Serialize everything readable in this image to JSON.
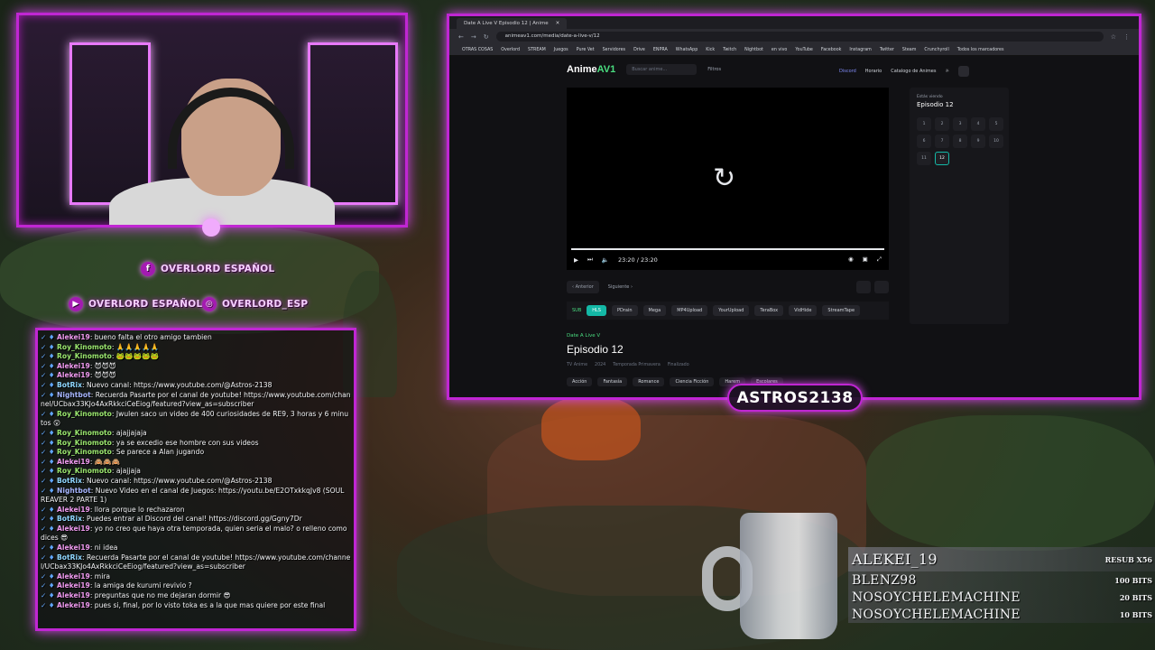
{
  "overlay": {
    "social_facebook": "OVERLORD ESPAÑOL",
    "social_youtube": "OVERLORD ESPAÑOL",
    "social_instagram": "OVERLORD_ESP",
    "streamer_name": "ASTROS2138"
  },
  "chat": [
    {
      "user": "Alekei19",
      "cls": "u-alekei",
      "msg": "bueno falta el otro amigo tambien"
    },
    {
      "user": "Roy_Kinomoto",
      "cls": "u-roy",
      "msg": "🙏🙏🙏🙏🙏"
    },
    {
      "user": "Roy_Kinomoto",
      "cls": "u-roy",
      "msg": "🐸🐸🐸🐸🐸"
    },
    {
      "user": "Alekei19",
      "cls": "u-alekei",
      "msg": "😈😈😈"
    },
    {
      "user": "Alekei19",
      "cls": "u-alekei",
      "msg": "😈😈😈"
    },
    {
      "user": "BotRix",
      "cls": "u-botrix",
      "msg": "Nuevo canal: https://www.youtube.com/@Astros-2138"
    },
    {
      "user": "Nightbot",
      "cls": "u-nightbot",
      "msg": "Recuerda Pasarte por el canal de youtube! https://www.youtube.com/channel/UCbax33KJo4AxRkkciCeEiog/featured?view_as=subscriber"
    },
    {
      "user": "Roy_Kinomoto",
      "cls": "u-roy",
      "msg": "Jwulen saco un video de 400 curiosidades de RE9, 3 horas y 6 minutos 😮"
    },
    {
      "user": "Roy_Kinomoto",
      "cls": "u-roy",
      "msg": "ajajjajaja"
    },
    {
      "user": "Roy_Kinomoto",
      "cls": "u-roy",
      "msg": "ya se excedio ese hombre con sus videos"
    },
    {
      "user": "Roy_Kinomoto",
      "cls": "u-roy",
      "msg": "Se parece a Alan jugando"
    },
    {
      "user": "Alekei19",
      "cls": "u-alekei",
      "msg": "🙈🙈🙈"
    },
    {
      "user": "Roy_Kinomoto",
      "cls": "u-roy",
      "msg": "ajajjaja"
    },
    {
      "user": "BotRix",
      "cls": "u-botrix",
      "msg": "Nuevo canal: https://www.youtube.com/@Astros-2138"
    },
    {
      "user": "Nightbot",
      "cls": "u-nightbot",
      "msg": "Nuevo Video en el canal de Juegos: https://youtu.be/E2OTxkkqJv8 (SOUL REAVER 2 PARTE 1)"
    },
    {
      "user": "Alekei19",
      "cls": "u-alekei",
      "msg": "llora porque lo rechazaron"
    },
    {
      "user": "BotRix",
      "cls": "u-botrix",
      "msg": "Puedes entrar al Discord del canal! https://discord.gg/Ggny7Dr"
    },
    {
      "user": "Alekei19",
      "cls": "u-alekei",
      "msg": "yo no creo que haya otra temporada, quien seria el malo? o relleno como dices 😎"
    },
    {
      "user": "Alekei19",
      "cls": "u-alekei",
      "msg": "ni idea"
    },
    {
      "user": "BotRix",
      "cls": "u-botrix",
      "msg": "Recuerda Pasarte por el canal de youtube! https://www.youtube.com/channel/UCbax33KJo4AxRkkciCeEiog/featured?view_as=subscriber"
    },
    {
      "user": "Alekei19",
      "cls": "u-alekei",
      "msg": "mira"
    },
    {
      "user": "Alekei19",
      "cls": "u-alekei",
      "msg": "la amiga de kurumi revivio ?"
    },
    {
      "user": "Alekei19",
      "cls": "u-alekei",
      "msg": "preguntas que no me dejaran dormir 😎"
    },
    {
      "user": "Alekei19",
      "cls": "u-alekei",
      "msg": "pues si, final, por lo visto toka es a la que mas quiere por este final"
    }
  ],
  "browser": {
    "tab_title": "Date A Live V Episodio 12 | Anime",
    "url": "animeav1.com/media/date-a-live-v/12",
    "bookmarks": [
      "OTRAS COSAS",
      "Overlord",
      "STREAM",
      "Juegos",
      "Pure Vet",
      "Servidores",
      "Drive",
      "ENPRA",
      "WhatsApp",
      "Kick",
      "Twitch",
      "Nightbot",
      "en vivo",
      "YouTube",
      "Facebook",
      "Instagram",
      "Twitter",
      "Steam",
      "Crunchyroll",
      "Todos los marcadores"
    ],
    "site": {
      "logo_text": "Anime",
      "logo_accent": "AV1",
      "search_placeholder": "Buscar anime...",
      "filters_label": "Filtros",
      "nav_discord": "Discord",
      "nav_schedule": "Horario",
      "nav_catalog": "Catalogo de Animes"
    },
    "player": {
      "time": "23:20 / 23:20",
      "replay_icon": "replay-icon"
    },
    "ep_nav": {
      "prev": "Anterior",
      "next": "Siguiente"
    },
    "servers": {
      "sub_label": "SUB",
      "list": [
        "HLS",
        "PDrain",
        "Mega",
        "MP4Upload",
        "YourUpload",
        "TeraBox",
        "VidHide",
        "StreamTape"
      ],
      "active": "HLS"
    },
    "anime_title": "Date A Live V",
    "episode_title": "Episodio 12",
    "meta": [
      "TV Anime",
      "2024",
      "Temporada Primavera",
      "Finalizado"
    ],
    "tags": [
      "Acción",
      "Fantasía",
      "Romance",
      "Ciencia Ficción",
      "Harem",
      "Escolares"
    ],
    "panel": {
      "watching_label": "Estás viendo",
      "watching_value": "Episodio 12",
      "episodes": [
        "1",
        "2",
        "3",
        "4",
        "5",
        "6",
        "7",
        "8",
        "9",
        "10",
        "11",
        "12"
      ],
      "active_episode": "12"
    }
  },
  "events": [
    {
      "name": "ALEKEI_19",
      "amount": "RESUB X56"
    },
    {
      "name": "BLENZ98",
      "amount": "100 BITS"
    },
    {
      "name": "NOSOYCHELEMACHINE",
      "amount": "20 BITS"
    },
    {
      "name": "NOSOYCHELEMACHINE",
      "amount": "10 BITS"
    }
  ],
  "colors": {
    "accent": "#c026d3",
    "site_green": "#4ade80",
    "server_active": "#14b8a6"
  }
}
